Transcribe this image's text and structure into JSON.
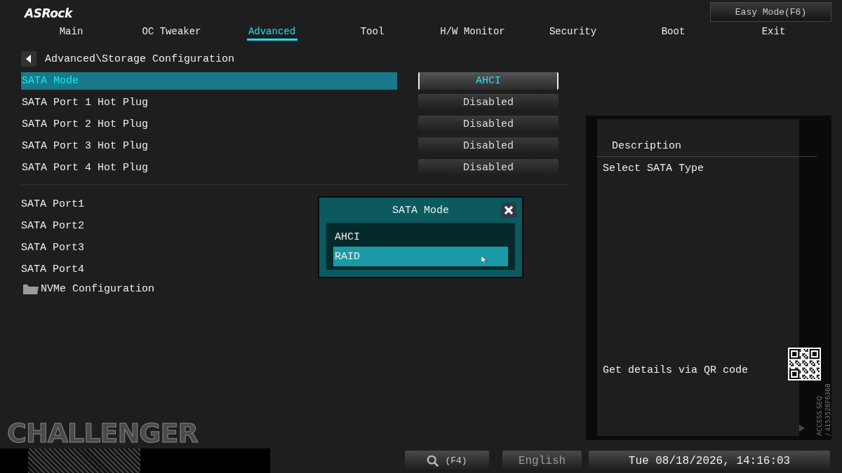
{
  "logo": "ASRock",
  "easy_mode": "Easy Mode(F6)",
  "tabs": [
    {
      "label": "Main",
      "selected": false
    },
    {
      "label": "OC Tweaker",
      "selected": false
    },
    {
      "label": "Advanced",
      "selected": true
    },
    {
      "label": "Tool",
      "selected": false
    },
    {
      "label": "H/W Monitor",
      "selected": false
    },
    {
      "label": "Security",
      "selected": false
    },
    {
      "label": "Boot",
      "selected": false
    },
    {
      "label": "Exit",
      "selected": false
    }
  ],
  "breadcrumb": "Advanced\\Storage Configuration",
  "settings": [
    {
      "label": "SATA Mode",
      "value": "AHCI",
      "selected": true
    },
    {
      "label": "SATA Port 1 Hot Plug",
      "value": "Disabled",
      "selected": false
    },
    {
      "label": "SATA Port 2 Hot Plug",
      "value": "Disabled",
      "selected": false
    },
    {
      "label": "SATA Port 3 Hot Plug",
      "value": "Disabled",
      "selected": false
    },
    {
      "label": "SATA Port 4 Hot Plug",
      "value": "Disabled",
      "selected": false
    }
  ],
  "ports": [
    "SATA Port1",
    "SATA Port2",
    "SATA Port3",
    "SATA Port4"
  ],
  "submenu": {
    "label": "NVMe Configuration"
  },
  "description": {
    "title": "Description",
    "text": "Select SATA Type",
    "qr_hint": "Get details via QR code",
    "access_seq": "ACCESS SEQ",
    "access_code": "/ 4153526F636B"
  },
  "dialog": {
    "title": "SATA Mode",
    "options": [
      {
        "label": "AHCI",
        "selected": false
      },
      {
        "label": "RAID",
        "selected": true
      }
    ]
  },
  "brand": "CHALLENGER",
  "footer": {
    "search_key": "(F4)",
    "language": "English",
    "datetime": "Tue 08/18/2026, 14:16:03"
  }
}
